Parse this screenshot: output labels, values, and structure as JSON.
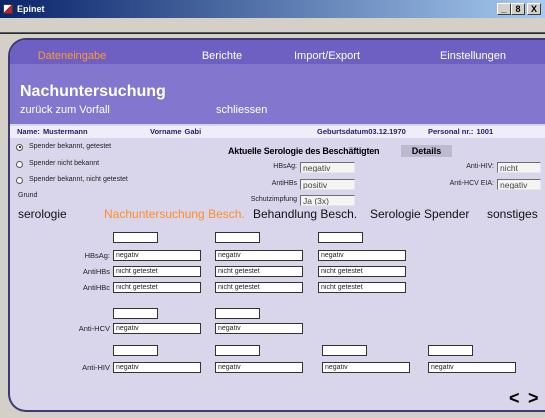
{
  "window": {
    "title": "Epinet",
    "controls": {
      "minimize": "_",
      "restore": "8",
      "close": "X"
    }
  },
  "colors": {
    "tab_bar": "#6e60c3",
    "header": "#8376cf",
    "panel": "#d9d6ec",
    "active_tab": "#ff9933",
    "active_subtab": "#ff8c2a"
  },
  "main_tabs": [
    {
      "label": "Dateneingabe",
      "active": true
    },
    {
      "label": "Berichte",
      "active": false
    },
    {
      "label": "Import/Export",
      "active": false
    },
    {
      "label": "Einstellungen",
      "active": false
    }
  ],
  "page_title": "Nachuntersuchung",
  "actions": {
    "back": "zurück zum Vorfall",
    "close": "schliessen"
  },
  "person": {
    "name": {
      "label": "Name:",
      "value": "Mustermann"
    },
    "first_name": {
      "label": "Vorname",
      "value": "Gabi"
    },
    "birth_date": {
      "label": "Geburtsdatum",
      "value": "03.12.1970"
    },
    "personnel_no": {
      "label": "Personal nr.:",
      "value": "1001"
    }
  },
  "donor_status": {
    "options": [
      {
        "label": "Spender bekannt, getestet",
        "selected": true
      },
      {
        "label": "Spender nicht bekannt",
        "selected": false
      },
      {
        "label": "Spender bekannt, nicht getestet",
        "selected": false
      }
    ],
    "reason_label": "Grund"
  },
  "current_serology": {
    "title": "Aktuelle Serologie des Beschäftigten",
    "details_button": "Details",
    "hbsag": {
      "label": "HBsAg:",
      "value": "negativ"
    },
    "antihbs": {
      "label": "AntiHBs",
      "value": "positiv"
    },
    "vaccination": {
      "label": "Schutzimpfung",
      "value": "Ja (3x)"
    },
    "anti_hiv": {
      "label": "Anti-HIV:",
      "value": "nicht"
    },
    "anti_hcv_eia": {
      "label": "Anti-HCV EIA:",
      "value": "negativ"
    }
  },
  "sub_tabs": [
    {
      "label": "serologie",
      "active": false
    },
    {
      "label": "Nachuntersuchung Besch.",
      "active": true
    },
    {
      "label": "Behandlung Besch.",
      "active": false
    },
    {
      "label": "Serologie Spender",
      "active": false
    },
    {
      "label": "sonstiges",
      "active": false
    }
  ],
  "follow_up": {
    "hepatitis_b": {
      "dates": [
        "",
        "",
        ""
      ],
      "rows": [
        {
          "label": "HBsAg:",
          "values": [
            "negativ",
            "negativ",
            "negativ"
          ]
        },
        {
          "label": "AntiHBs",
          "values": [
            "nicht getestet",
            "nicht getestet",
            "nicht getestet"
          ]
        },
        {
          "label": "AntiHBc",
          "values": [
            "nicht getestet",
            "nicht getestet",
            "nicht getestet"
          ]
        }
      ]
    },
    "hepatitis_c": {
      "dates": [
        "",
        ""
      ],
      "rows": [
        {
          "label": "Anti-HCV",
          "values": [
            "negativ",
            "negativ"
          ]
        }
      ]
    },
    "hiv": {
      "dates": [
        "",
        "",
        "",
        ""
      ],
      "rows": [
        {
          "label": "Anti-HIV",
          "values": [
            "negativ",
            "negativ",
            "negativ",
            "negativ"
          ]
        }
      ]
    }
  },
  "pager": {
    "prev": "<",
    "next": ">"
  }
}
